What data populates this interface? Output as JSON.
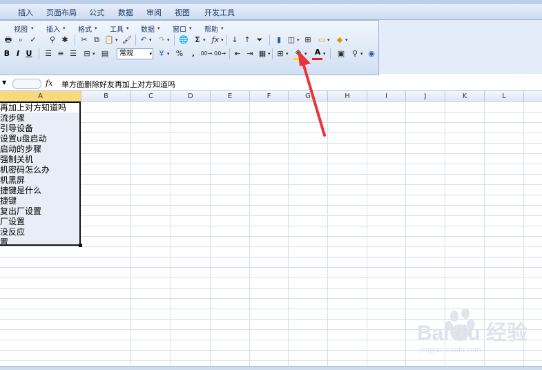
{
  "menubar": {
    "items": [
      "插入",
      "页面布局",
      "公式",
      "数据",
      "审阅",
      "视图",
      "开发工具"
    ]
  },
  "ribbon": {
    "submenu": [
      "视图",
      "插入",
      "格式",
      "工具",
      "数据",
      "窗口",
      "帮助"
    ],
    "format": {
      "bold": "B",
      "italic": "I",
      "underline": "U",
      "number_format": "常规",
      "percent": "%",
      "comma": ",",
      "inc_decimal": ".00→.0",
      "font_color": "A"
    },
    "colors": {
      "fill_color": "#f5e600",
      "font_color": "#e02020",
      "annotation_arrow": "#e8343a"
    }
  },
  "formula_bar": {
    "fx": "fx",
    "content": "单方面删除好友再加上对方知道吗"
  },
  "columns": [
    "A",
    "B",
    "C",
    "D",
    "E",
    "F",
    "G",
    "H",
    "I",
    "J",
    "K",
    "L"
  ],
  "cells": [
    "再加上对方知道吗",
    "流步骤",
    "引导设备",
    "设置u盘启动",
    "启动的步骤",
    "强制关机",
    "机密码怎么办",
    "机黑屏",
    "捷键是什么",
    "捷键",
    "复出厂设置",
    "厂设置",
    "没反应",
    "置"
  ],
  "watermark": {
    "brand": "Bai du 经验",
    "url": "jingyan.baidu.com"
  }
}
